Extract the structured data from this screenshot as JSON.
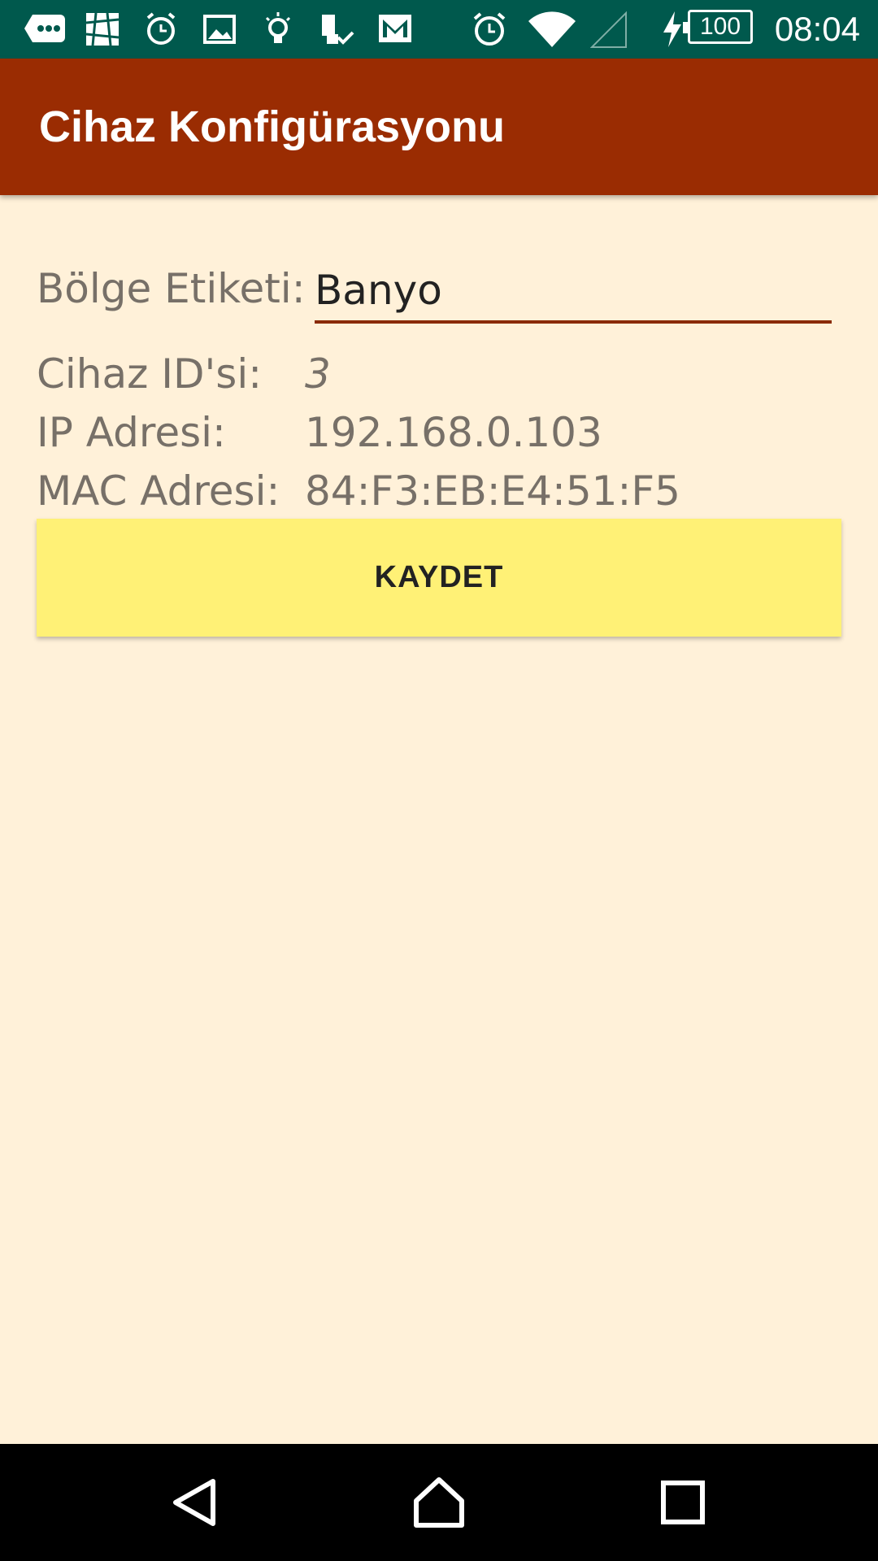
{
  "status_bar": {
    "time": "08:04",
    "battery_level": "100",
    "icons": [
      "chat-icon",
      "app-icon",
      "alarm-icon",
      "image-icon",
      "lightbulb-icon",
      "device-check-icon",
      "gmail-icon",
      "alarm-clock-icon",
      "wifi-icon",
      "cell-signal-icon",
      "charging-bolt-icon",
      "battery-icon"
    ]
  },
  "app_bar": {
    "title": "Cihaz Konfigürasyonu"
  },
  "form": {
    "zone_label": "Bölge Etiketi:",
    "zone_value": "Banyo",
    "device_id_label": "Cihaz ID'si:",
    "device_id_value": "3",
    "ip_label": "IP Adresi:",
    "ip_value": "192.168.0.103",
    "mac_label": "MAC Adresi:",
    "mac_value": "84:F3:EB:E4:51:F5",
    "save_label": "KAYDET"
  },
  "colors": {
    "status_bar": "#00594D",
    "app_bar": "#9A2C02",
    "background": "#FFF1D9",
    "save_button": "#FFF176",
    "input_underline": "#8A2A04"
  }
}
